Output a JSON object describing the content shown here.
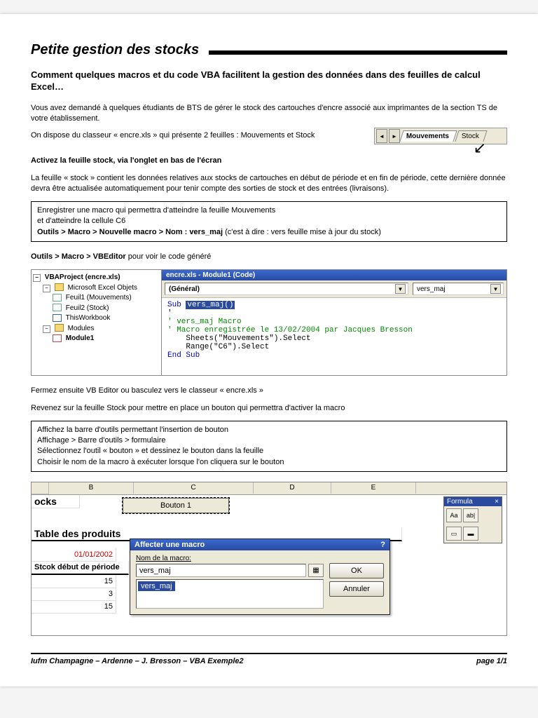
{
  "title": "Petite gestion des stocks",
  "subtitle": "Comment quelques macros et du code VBA facilitent la gestion des données dans des feuilles de calcul Excel…",
  "p1": "Vous avez demandé à quelques étudiants de BTS de gérer le stock des cartouches d'encre associé aux imprimantes de la section TS de votre établissement.",
  "p2": "On dispose du classeur « encre.xls » qui présente 2 feuilles : Mouvements et Stock",
  "h3a": "Activez la feuille stock, via l'onglet en bas de l'écran",
  "p3": "La feuille « stock » contient les données relatives aux stocks de cartouches en début de période et en fin de période, cette dernière donnée devra être actualisée automatiquement pour tenir compte des sorties de stock et des entrées (livraisons).",
  "box1_l1": "Enregistrer une macro qui permettra d'atteindre la feuille Mouvements",
  "box1_l2": "et d'atteindre la cellule C6",
  "box1_l3a": "Outils > Macro > Nouvelle macro > Nom : vers_maj",
  "box1_l3b": " (c'est à dire : vers feuille mise à jour du stock)",
  "h3b_a": "Outils > Macro > VBEditor",
  "h3b_b": " pour voir le code généré",
  "vb": {
    "project": "VBAProject (encre.xls)",
    "folder1": "Microsoft Excel Objets",
    "sheet1": "Feuil1 (Mouvements)",
    "sheet2": "Feuil2 (Stock)",
    "wb": "ThisWorkbook",
    "folder2": "Modules",
    "mod1": "Module1",
    "codeTitle": "encre.xls - Module1 (Code)",
    "ddGeneral": "(Général)",
    "ddProc": "vers_maj",
    "code_sub": "Sub ",
    "code_name": "vers_maj()",
    "code_c1": "' vers_maj Macro",
    "code_c2": "' Macro enregistrée le 13/02/2004 par Jacques Bresson",
    "code_l1": "    Sheets(\"Mouvements\").Select",
    "code_l2": "    Range(\"C6\").Select",
    "code_end": "End Sub"
  },
  "p4": "Fermez ensuite VB Editor ou basculez vers le classeur « encre.xls »",
  "p5": "Revenez sur la feuille Stock pour mettre en place un bouton qui permettra d'activer la macro",
  "box2_l1": "Affichez la barre d'outils permettant l'insertion de bouton",
  "box2_l2": "Affichage > Barre d'outils > formulaire",
  "box2_l3": "Sélectionnez l'outil « bouton » et dessinez le bouton dans la feuille",
  "box2_l4": "Choisir le nom de la macro à exécuter lorsque l'on cliquera sur le bouton",
  "tabs": {
    "t1": "Mouvements",
    "t2": "Stock"
  },
  "excel": {
    "cols": {
      "b": "B",
      "c": "C",
      "d": "D",
      "e": "E"
    },
    "a1": "ocks",
    "btn": "Bouton 1",
    "formToolbar": "Formula",
    "tb_aa": "Aa",
    "tb_ab": "ab|",
    "tableTitle": "Table des produits",
    "date": "01/01/2002",
    "rowLabel": "Stcok début de période",
    "v1": "15",
    "v2": "3",
    "v3": "15",
    "dlgTitle": "Affecter une macro",
    "dlgLabel": "Nom de la macro:",
    "dlgValue": "vers_maj",
    "dlgListItem": "vers_maj",
    "ok": "OK",
    "cancel": "Annuler",
    "help": "?",
    "close": "×"
  },
  "footer_left": "Iufm Champagne – Ardenne – J. Bresson – VBA Exemple2",
  "footer_right": "page 1/1"
}
